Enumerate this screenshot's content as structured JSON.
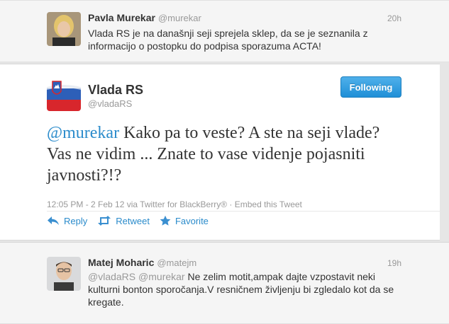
{
  "reply_above": {
    "name": "Pavla Murekar",
    "handle": "@murekar",
    "time": "20h",
    "text_line1": "Vlada RS je na današnji seji sprejela sklep, da se je seznanila z",
    "text_line2": "informacijo o postopku do podpisa sporazuma ACTA!"
  },
  "main_tweet": {
    "name": "Vlada RS",
    "handle": "@vladaRS",
    "follow_label": "Following",
    "mention": "@murekar",
    "text_line1": " Kako pa to veste? A ste na seji vlade?",
    "text_line2": "Vas ne vidim ... Znate to vase videnje pojasniti",
    "text_line3": "javnosti?!?",
    "meta": "12:05 PM - 2 Feb 12 via Twitter for BlackBerry® · Embed this Tweet",
    "actions": {
      "reply": "Reply",
      "retweet": "Retweet",
      "favorite": "Favorite"
    }
  },
  "reply_below": {
    "name": "Matej Moharic",
    "handle": "@matejm",
    "time": "19h",
    "mention1": "@vladaRS",
    "mention2": "@murekar",
    "text_line1": " Ne zelim motit,ampak dajte vzpostavit neki",
    "text_line2": "kulturni bonton sporočanja.V resničnem življenju bi zgledalo kot da se",
    "text_line3": "kregate."
  },
  "colors": {
    "link": "#2a8bcb",
    "button": "#1f8fd7",
    "muted": "#999999"
  }
}
